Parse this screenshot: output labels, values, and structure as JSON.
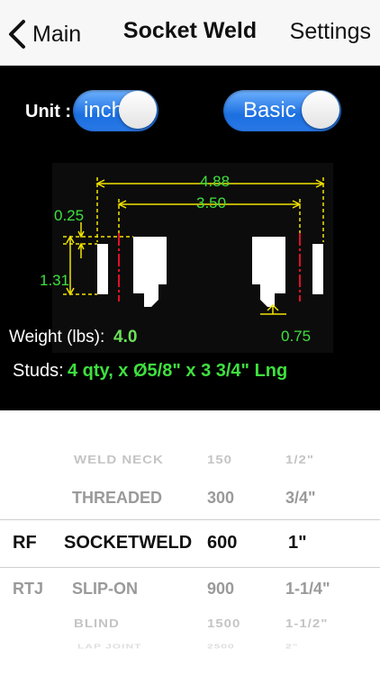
{
  "nav": {
    "back_label": "Main",
    "title": "Socket Weld",
    "right_label": "Settings"
  },
  "controls": {
    "unit_label": "Unit :",
    "unit_toggle": "inch",
    "mode_toggle": "Basic"
  },
  "diagram": {
    "dims": {
      "overall": "4.88",
      "bolt_circle": "3.50",
      "raised_face": "0.25",
      "thickness": "1.31",
      "socket_depth": "0.75"
    },
    "colors": {
      "dimension": "#f2e400",
      "value": "#3fe03f",
      "centerline": "#e0102a"
    }
  },
  "info": {
    "weight_label": "Weight (lbs):",
    "weight_value": "4.0",
    "studs_label": "Studs:",
    "studs_value": "4 qty, x Ø5/8\" x 3 3/4\" Lng"
  },
  "picker": {
    "face_types": [
      "",
      "",
      "RF",
      "RTJ"
    ],
    "flange_types": [
      "WELD NECK",
      "THREADED",
      "SOCKETWELD",
      "SLIP-ON",
      "BLIND",
      "LAP JOINT"
    ],
    "classes": [
      "150",
      "300",
      "600",
      "900",
      "1500",
      "2500"
    ],
    "sizes": [
      "1/2\"",
      "3/4\"",
      "1\"",
      "1-1/4\"",
      "1-1/2\"",
      "2\""
    ],
    "selected": {
      "face": "RF",
      "flange": "SOCKETWELD",
      "class": "600",
      "size": "1\""
    }
  }
}
